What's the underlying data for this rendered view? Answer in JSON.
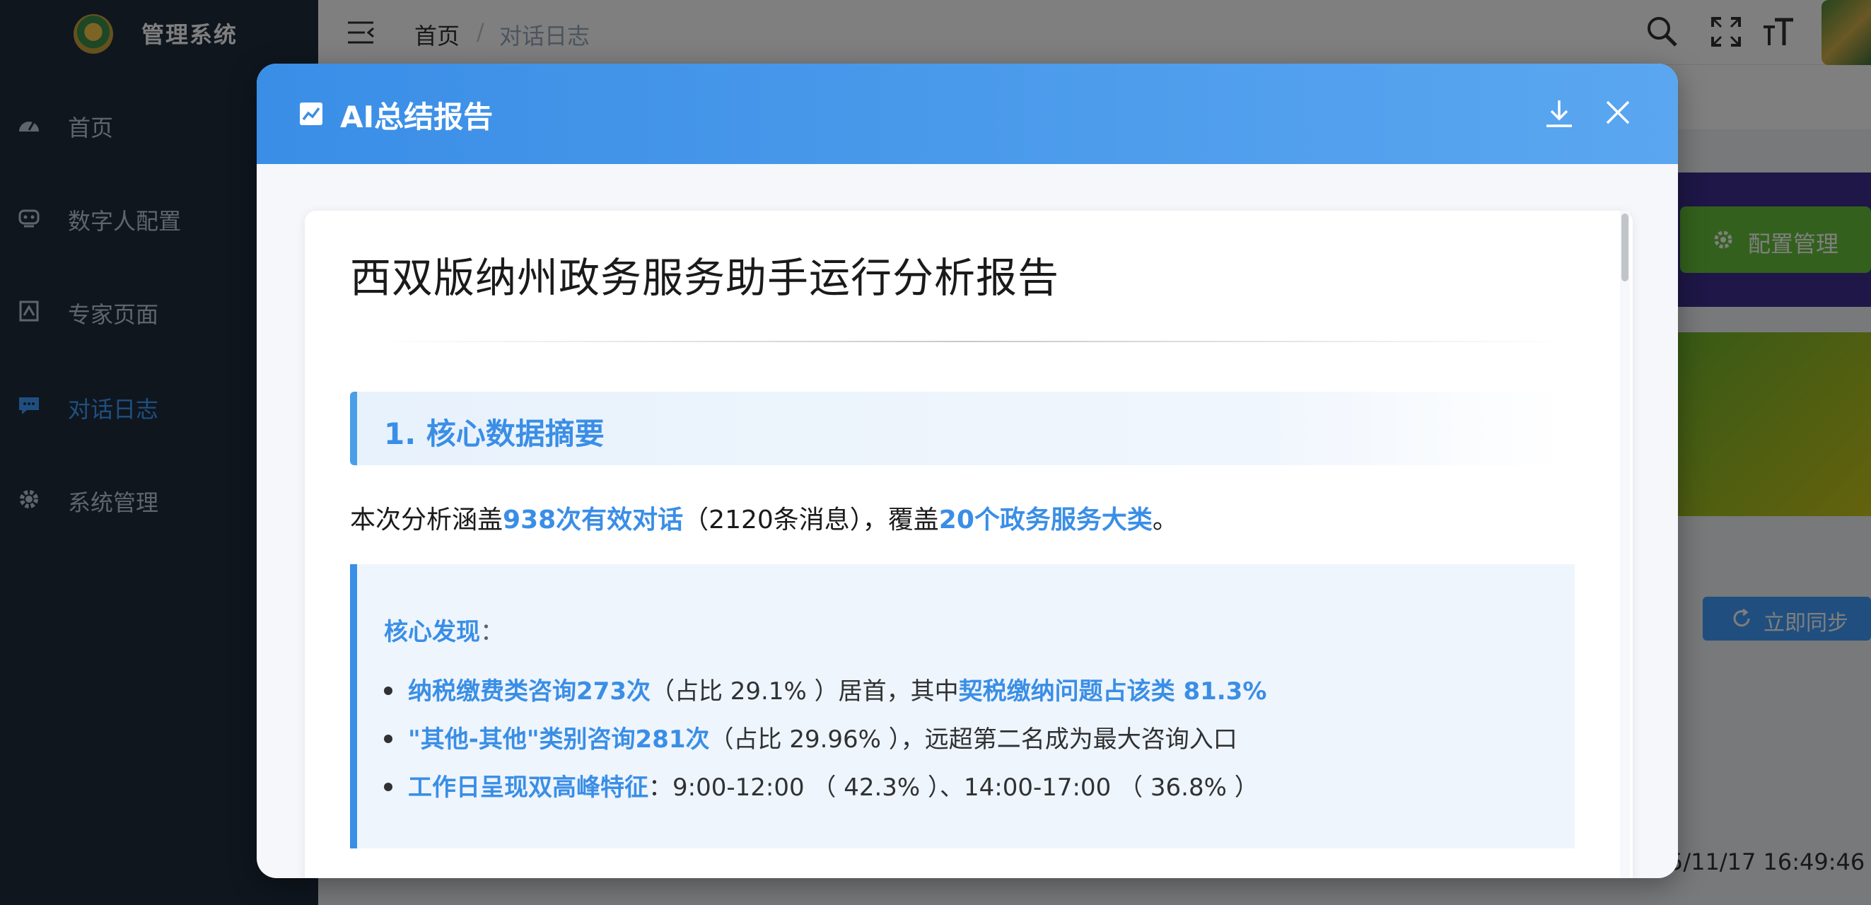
{
  "app": {
    "title": "管理系统"
  },
  "sidebar": {
    "items": [
      {
        "label": "首页",
        "icon": "dashboard-icon"
      },
      {
        "label": "数字人配置",
        "icon": "robot-icon"
      },
      {
        "label": "专家页面",
        "icon": "expert-icon"
      },
      {
        "label": "对话日志",
        "icon": "chat-icon",
        "active": true
      },
      {
        "label": "系统管理",
        "icon": "gear-icon"
      }
    ]
  },
  "breadcrumb": {
    "home": "首页",
    "separator": "/",
    "current": "对话日志"
  },
  "background": {
    "config_button": "配置管理",
    "sync_button": "立即同步",
    "timestamp_partial": "5/11/17 16:49:46"
  },
  "dialog": {
    "title": "AI总结报告",
    "report": {
      "title": "西双版纳州政务服务助手运行分析报告",
      "section1_title": "1. 核心数据摘要",
      "summary": {
        "prefix": "本次分析涵盖",
        "dialogs": "938次有效对话",
        "messages": "（2120条消息），覆盖",
        "categories": "20个政务服务大类",
        "suffix": "。"
      },
      "findings": {
        "title": "核心发现",
        "colon": "：",
        "items": [
          {
            "hl1": "纳税缴费类咨询273次",
            "text1": "（占比 29.1% ）居首，其中",
            "hl2": "契税缴纳问题占该类 81.3%"
          },
          {
            "hl1": "\"其他-其他\"类别咨询281次",
            "text1": "（占比 29.96% ），远超第二名成为最大咨询入口"
          },
          {
            "hl1": "工作日呈现双高峰特征",
            "text1": "：9:00-12:00 （ 42.3% ）、14:00-17:00 （ 36.8% ）"
          }
        ]
      }
    }
  },
  "colors": {
    "accent": "#3a8ee6",
    "sidebar_bg": "#1f2d3d",
    "header_gradient_start": "#3a8ee6",
    "header_gradient_end": "#5aa6f0"
  }
}
